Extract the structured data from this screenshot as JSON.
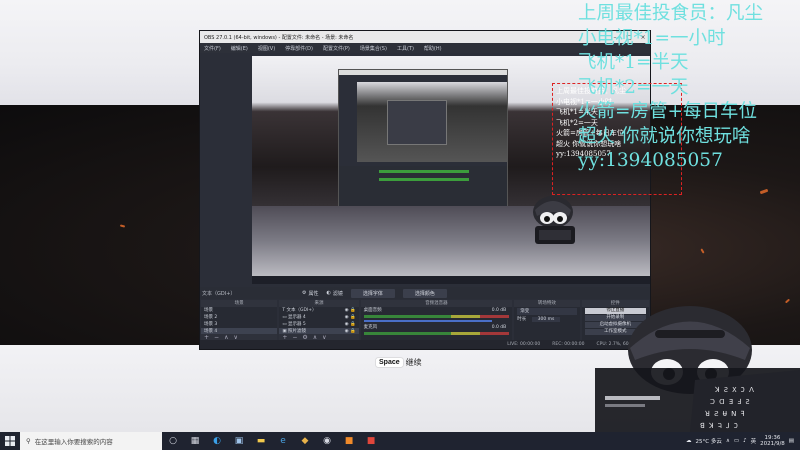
{
  "obs": {
    "title": "OBS 27.0.1 (64-bit, windows) - 配置文件: 未命名 - 场景: 未命名",
    "menu": [
      "文件(F)",
      "编辑(E)",
      "视图(V)",
      "停靠部件(D)",
      "配置文件(P)",
      "场景集合(S)",
      "工具(T)",
      "帮助(H)"
    ],
    "source_label": "文本（GDI+）",
    "source_options": [
      "属性",
      "滤镜"
    ],
    "source_buttons": [
      "选择字体",
      "选择颜色"
    ],
    "docks": {
      "scenes_header": "场景",
      "scenes": [
        "场景",
        "场景 2",
        "场景 3",
        "场景 4"
      ],
      "sources_header": "来源",
      "sources": [
        "文本（GDI+）",
        "显示器 4",
        "显示器 5",
        "照片滤镜"
      ],
      "mixer_header": "音频混音器",
      "mixer_tracks": [
        {
          "name": "桌面音频",
          "db": "0.0 dB"
        },
        {
          "name": "麦克风",
          "db": "0.0 dB"
        }
      ],
      "transitions_header": "转场特效",
      "transition_type": "渐变",
      "duration_label": "时长",
      "duration_value": "300 ms",
      "controls_header": "控件",
      "controls": [
        "停止直播",
        "开始录制",
        "启动虚拟摄像机",
        "工作室模式",
        "设置",
        "退出"
      ]
    },
    "status": {
      "live": "LIVE: 00:00:00",
      "rec": "REC: 00:00:00",
      "cpu": "CPU: 2.7%, 60.00 fps"
    }
  },
  "overlay": {
    "lines": [
      "上周最佳投食员：凡尘",
      "小电视*1=一小时",
      "飞机*1=半天",
      "飞机*2=一天",
      "火箭=房管+每日车位",
      "超火 你就说你想玩啥",
      "yy:1394085057"
    ],
    "color": "#6fe0df"
  },
  "continue_prompt": {
    "key": "Space",
    "label": "继续"
  },
  "taskbar": {
    "search_placeholder": "在这里输入你要搜索的内容",
    "weather": "25°C 多云",
    "ime": "英",
    "time": "19:36",
    "date": "2021/9/8"
  }
}
